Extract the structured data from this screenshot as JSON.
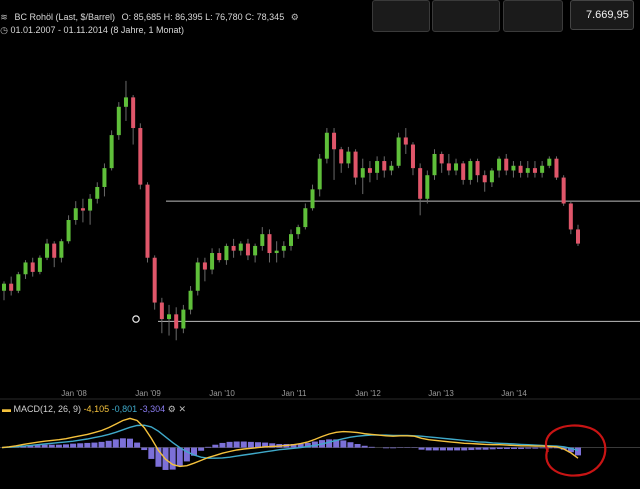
{
  "header": {
    "instrument": "BC Rohöl (Last, $/Barrel)",
    "ohlc": "O: 85,685  H: 86,395  L: 76,780  C: 78,345",
    "range": "01.01.2007 - 01.11.2014 (8 Jahre, 1 Monat)"
  },
  "top_widgets": {
    "price": "7.669,95"
  },
  "macd_label": {
    "name": "MACD(12, 26, 9)",
    "v1": "-4,105",
    "v2": "-0,801",
    "v3": "-3,304"
  },
  "colors": {
    "up": "#5fbf3a",
    "down": "#e0566a",
    "macd_line": "#f5c23c",
    "signal_line": "#3fa9c9",
    "histogram": "#8a7cf0",
    "hline": "#bdbdbd",
    "circle": "#c81414"
  },
  "chart_data": {
    "type": "candlestick",
    "x_tick_labels": [
      "Jan '08",
      "Jan '09",
      "Jan '10",
      "Jan '11",
      "Jan '12",
      "Jan '13",
      "Jan '14"
    ],
    "xlim": [
      "2007-01",
      "2014-11"
    ],
    "ylim": [
      35,
      155
    ],
    "horizontal_lines": [
      96,
      45
    ],
    "marker_value": 46,
    "candles": [
      {
        "o": 58,
        "h": 62,
        "l": 54,
        "c": 61
      },
      {
        "o": 61,
        "h": 64,
        "l": 56,
        "c": 58
      },
      {
        "o": 58,
        "h": 66,
        "l": 57,
        "c": 65
      },
      {
        "o": 65,
        "h": 71,
        "l": 63,
        "c": 70
      },
      {
        "o": 70,
        "h": 72,
        "l": 64,
        "c": 66
      },
      {
        "o": 66,
        "h": 73,
        "l": 65,
        "c": 72
      },
      {
        "o": 72,
        "h": 80,
        "l": 71,
        "c": 78
      },
      {
        "o": 78,
        "h": 79,
        "l": 68,
        "c": 72
      },
      {
        "o": 72,
        "h": 80,
        "l": 70,
        "c": 79
      },
      {
        "o": 79,
        "h": 90,
        "l": 78,
        "c": 88
      },
      {
        "o": 88,
        "h": 96,
        "l": 86,
        "c": 93
      },
      {
        "o": 93,
        "h": 97,
        "l": 87,
        "c": 92
      },
      {
        "o": 92,
        "h": 99,
        "l": 86,
        "c": 97
      },
      {
        "o": 97,
        "h": 104,
        "l": 95,
        "c": 102
      },
      {
        "o": 102,
        "h": 112,
        "l": 98,
        "c": 110
      },
      {
        "o": 110,
        "h": 126,
        "l": 109,
        "c": 124
      },
      {
        "o": 124,
        "h": 138,
        "l": 122,
        "c": 136
      },
      {
        "o": 136,
        "h": 147,
        "l": 130,
        "c": 140
      },
      {
        "o": 140,
        "h": 141,
        "l": 120,
        "c": 127
      },
      {
        "o": 127,
        "h": 129,
        "l": 101,
        "c": 103
      },
      {
        "o": 103,
        "h": 104,
        "l": 70,
        "c": 72
      },
      {
        "o": 72,
        "h": 73,
        "l": 50,
        "c": 53
      },
      {
        "o": 53,
        "h": 55,
        "l": 40,
        "c": 46
      },
      {
        "o": 46,
        "h": 52,
        "l": 39,
        "c": 48
      },
      {
        "o": 48,
        "h": 51,
        "l": 37,
        "c": 42
      },
      {
        "o": 42,
        "h": 52,
        "l": 40,
        "c": 50
      },
      {
        "o": 50,
        "h": 60,
        "l": 48,
        "c": 58
      },
      {
        "o": 58,
        "h": 72,
        "l": 56,
        "c": 70
      },
      {
        "o": 70,
        "h": 72,
        "l": 62,
        "c": 67
      },
      {
        "o": 67,
        "h": 76,
        "l": 65,
        "c": 74
      },
      {
        "o": 74,
        "h": 76,
        "l": 70,
        "c": 71
      },
      {
        "o": 71,
        "h": 78,
        "l": 69,
        "c": 77
      },
      {
        "o": 77,
        "h": 80,
        "l": 72,
        "c": 75
      },
      {
        "o": 75,
        "h": 79,
        "l": 73,
        "c": 78
      },
      {
        "o": 78,
        "h": 80,
        "l": 71,
        "c": 73
      },
      {
        "o": 73,
        "h": 78,
        "l": 70,
        "c": 77
      },
      {
        "o": 77,
        "h": 85,
        "l": 75,
        "c": 82
      },
      {
        "o": 82,
        "h": 84,
        "l": 70,
        "c": 74
      },
      {
        "o": 74,
        "h": 79,
        "l": 70,
        "c": 75
      },
      {
        "o": 75,
        "h": 79,
        "l": 72,
        "c": 77
      },
      {
        "o": 77,
        "h": 84,
        "l": 75,
        "c": 82
      },
      {
        "o": 82,
        "h": 86,
        "l": 80,
        "c": 85
      },
      {
        "o": 85,
        "h": 95,
        "l": 84,
        "c": 93
      },
      {
        "o": 93,
        "h": 103,
        "l": 92,
        "c": 101
      },
      {
        "o": 101,
        "h": 116,
        "l": 98,
        "c": 114
      },
      {
        "o": 114,
        "h": 127,
        "l": 112,
        "c": 125
      },
      {
        "o": 125,
        "h": 127,
        "l": 105,
        "c": 118
      },
      {
        "o": 118,
        "h": 119,
        "l": 108,
        "c": 112
      },
      {
        "o": 112,
        "h": 119,
        "l": 110,
        "c": 117
      },
      {
        "o": 117,
        "h": 118,
        "l": 103,
        "c": 106
      },
      {
        "o": 106,
        "h": 114,
        "l": 99,
        "c": 110
      },
      {
        "o": 110,
        "h": 113,
        "l": 104,
        "c": 108
      },
      {
        "o": 108,
        "h": 115,
        "l": 105,
        "c": 113
      },
      {
        "o": 113,
        "h": 115,
        "l": 106,
        "c": 109
      },
      {
        "o": 109,
        "h": 113,
        "l": 107,
        "c": 111
      },
      {
        "o": 111,
        "h": 125,
        "l": 110,
        "c": 123
      },
      {
        "o": 123,
        "h": 127,
        "l": 116,
        "c": 120
      },
      {
        "o": 120,
        "h": 121,
        "l": 107,
        "c": 110
      },
      {
        "o": 110,
        "h": 112,
        "l": 90,
        "c": 97
      },
      {
        "o": 97,
        "h": 109,
        "l": 95,
        "c": 107
      },
      {
        "o": 107,
        "h": 118,
        "l": 105,
        "c": 116
      },
      {
        "o": 116,
        "h": 117,
        "l": 108,
        "c": 112
      },
      {
        "o": 112,
        "h": 116,
        "l": 107,
        "c": 109
      },
      {
        "o": 109,
        "h": 114,
        "l": 107,
        "c": 112
      },
      {
        "o": 112,
        "h": 113,
        "l": 103,
        "c": 105
      },
      {
        "o": 105,
        "h": 114,
        "l": 103,
        "c": 113
      },
      {
        "o": 113,
        "h": 114,
        "l": 104,
        "c": 107
      },
      {
        "o": 107,
        "h": 109,
        "l": 100,
        "c": 104
      },
      {
        "o": 104,
        "h": 110,
        "l": 102,
        "c": 109
      },
      {
        "o": 109,
        "h": 115,
        "l": 106,
        "c": 114
      },
      {
        "o": 114,
        "h": 116,
        "l": 107,
        "c": 109
      },
      {
        "o": 109,
        "h": 113,
        "l": 106,
        "c": 111
      },
      {
        "o": 111,
        "h": 113,
        "l": 106,
        "c": 108
      },
      {
        "o": 108,
        "h": 113,
        "l": 106,
        "c": 110
      },
      {
        "o": 110,
        "h": 113,
        "l": 106,
        "c": 108
      },
      {
        "o": 108,
        "h": 113,
        "l": 106,
        "c": 111
      },
      {
        "o": 111,
        "h": 115,
        "l": 110,
        "c": 114
      },
      {
        "o": 114,
        "h": 115,
        "l": 105,
        "c": 106
      },
      {
        "o": 106,
        "h": 107,
        "l": 94,
        "c": 95
      },
      {
        "o": 95,
        "h": 96,
        "l": 82,
        "c": 84
      },
      {
        "o": 84,
        "h": 86,
        "l": 77,
        "c": 78
      }
    ],
    "macd": {
      "name": "MACD(12, 26, 9)",
      "ylim": [
        -8,
        10
      ],
      "macd_line": [
        0,
        0.2,
        0.5,
        0.9,
        1.2,
        1.5,
        1.8,
        2,
        2.2,
        2.5,
        2.9,
        3.3,
        3.7,
        4.2,
        4.8,
        5.6,
        6.6,
        7.6,
        8.2,
        7.6,
        5.6,
        2.6,
        -0.8,
        -3.3,
        -4.8,
        -5.3,
        -5.1,
        -4.4,
        -3.6,
        -2.8,
        -2.2,
        -1.6,
        -1.1,
        -0.7,
        -0.4,
        -0.2,
        0,
        0.2,
        0.3,
        0.4,
        0.6,
        0.8,
        1.1,
        1.6,
        2.3,
        3.1,
        3.8,
        4.3,
        4.5,
        4.4,
        4.2,
        3.9,
        3.7,
        3.5,
        3.3,
        3.2,
        3.3,
        3.3,
        3.2,
        2.6,
        2.2,
        2,
        1.8,
        1.6,
        1.4,
        1.2,
        1.1,
        1,
        0.9,
        0.8,
        0.8,
        0.7,
        0.6,
        0.5,
        0.5,
        0.4,
        0.4,
        0.3,
        0.2,
        -0.4,
        -1.5,
        -3
      ],
      "signal_line": [
        0,
        0.1,
        0.2,
        0.4,
        0.6,
        0.8,
        1,
        1.2,
        1.4,
        1.6,
        1.8,
        2.1,
        2.4,
        2.8,
        3.2,
        3.7,
        4.3,
        5,
        5.7,
        6.2,
        6.3,
        5.8,
        4.6,
        3,
        1.4,
        0,
        -1.2,
        -2.1,
        -2.7,
        -3,
        -3,
        -2.9,
        -2.7,
        -2.4,
        -2.1,
        -1.8,
        -1.5,
        -1.2,
        -0.9,
        -0.6,
        -0.4,
        -0.2,
        0,
        0.3,
        0.6,
        1,
        1.5,
        2,
        2.5,
        2.9,
        3.2,
        3.4,
        3.5,
        3.5,
        3.5,
        3.4,
        3.4,
        3.4,
        3.3,
        3.2,
        3,
        2.8,
        2.6,
        2.4,
        2.2,
        2,
        1.8,
        1.6,
        1.5,
        1.3,
        1.2,
        1.1,
        1,
        0.9,
        0.8,
        0.7,
        0.6,
        0.5,
        0.4,
        0.2,
        -0.2,
        -0.8
      ]
    }
  }
}
